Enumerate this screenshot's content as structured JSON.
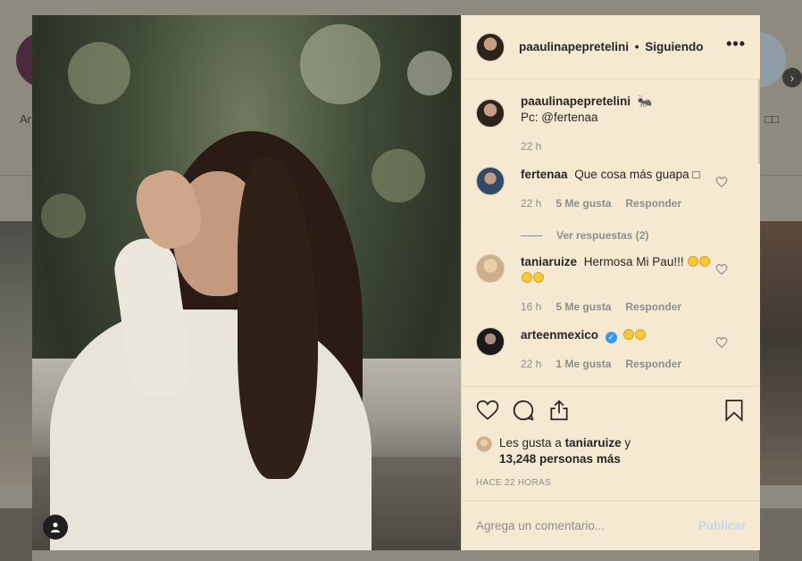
{
  "background_page": {
    "story_left_label": "Ar",
    "story_right_label": "□□",
    "next_arrow": "›"
  },
  "post": {
    "author": "paaulinapepretelini",
    "follow_status": "Siguiendo",
    "separator": "•",
    "more_icon": "•••",
    "caption": {
      "username": "paaulinapepretelini",
      "text": "🐜",
      "credit": "Pc: @fertenaa",
      "time": "22 h"
    },
    "comments": [
      {
        "username": "fertenaa",
        "text": "Que cosa más guapa □",
        "time": "22 h",
        "likes": "5 Me gusta",
        "reply": "Responder",
        "view_replies": "Ver respuestas (2)"
      },
      {
        "username": "taniaruize",
        "text": "Hermosa Mi Pau!!!",
        "time": "16 h",
        "likes": "5 Me gusta",
        "reply": "Responder"
      },
      {
        "username": "arteenmexico",
        "verified_mark": "✓",
        "text": "",
        "time": "22 h",
        "likes": "1 Me gusta",
        "reply": "Responder"
      }
    ],
    "likes": {
      "prefix": "Les gusta a",
      "liker": "taniaruize",
      "connector": "y",
      "count_text": "13,248 personas más"
    },
    "timestamp": "HACE 22 HORAS",
    "comment_placeholder": "Agrega un comentario...",
    "publish_label": "Publicar"
  },
  "colors": {
    "panel_bg": "#f5e9d2",
    "verified": "#3897f0",
    "muted_text": "#8e8e8e",
    "publish_disabled": "#c6d7ea"
  },
  "icons": [
    "heart-icon",
    "comment-icon",
    "share-icon",
    "bookmark-icon",
    "more-icon",
    "user-tag-icon",
    "chevron-right-icon"
  ]
}
